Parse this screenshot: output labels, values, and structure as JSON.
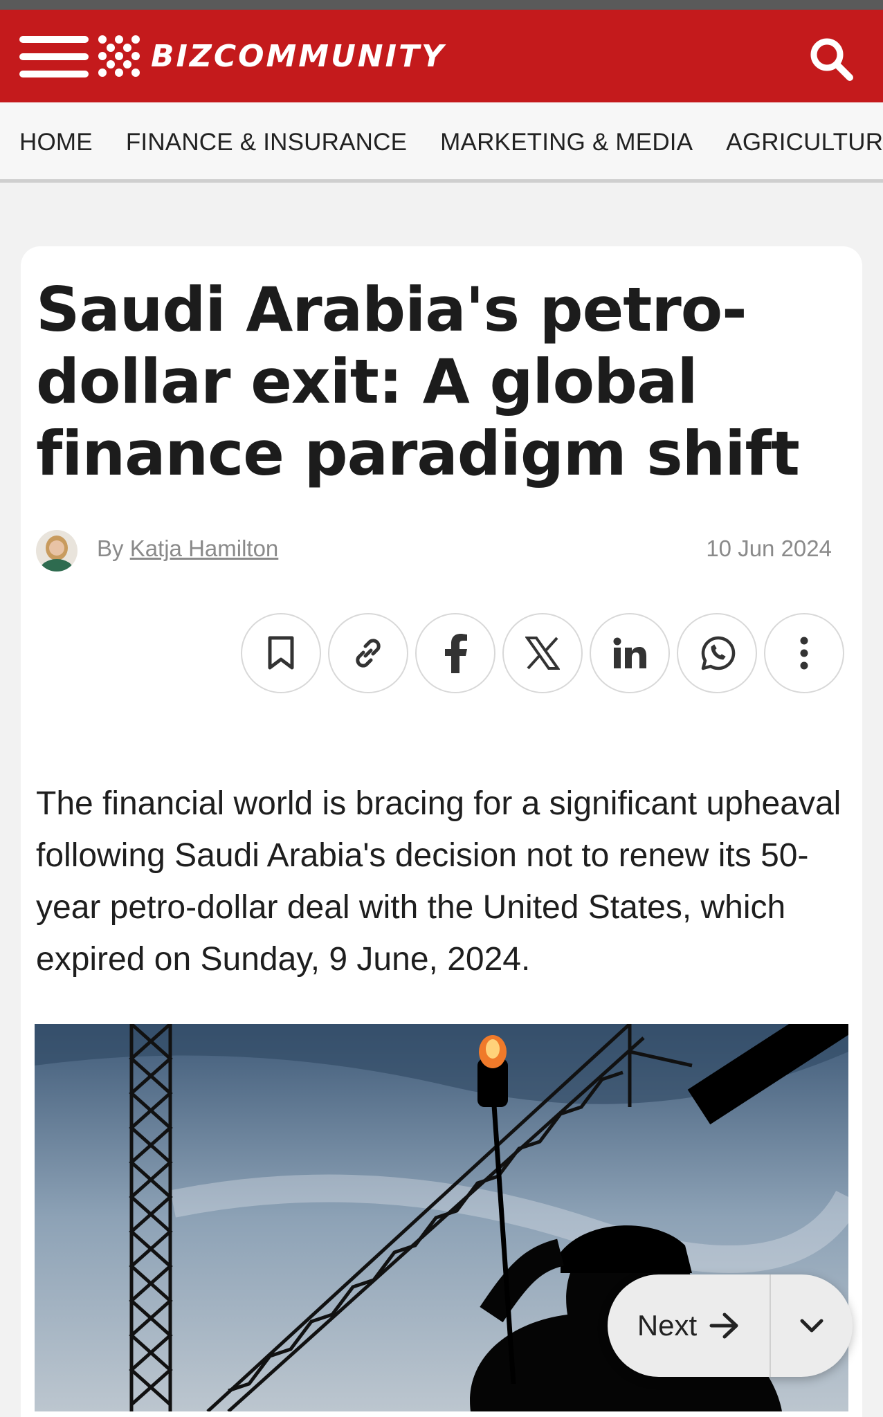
{
  "header": {
    "logo_text": "BIZCOMMUNITY",
    "brand_color": "#c41a1c",
    "icons": [
      "menu-icon",
      "search-icon"
    ]
  },
  "nav": {
    "items": [
      {
        "label": "HOME"
      },
      {
        "label": "FINANCE & INSURANCE"
      },
      {
        "label": "MARKETING & MEDIA"
      },
      {
        "label": "AGRICULTURE"
      }
    ]
  },
  "article": {
    "title": "Saudi Arabia's petro-dollar exit: A global finance paradigm shift",
    "byline_prefix": "By",
    "author": "Katja Hamilton",
    "date": "10 Jun 2024",
    "lead": "The financial world is bracing for a significant upheaval following Saudi Arabia's decision not to renew its 50-year petro-dollar deal with the United States, which expired on Sunday, 9 June, 2024."
  },
  "share": {
    "icons": [
      "bookmark-icon",
      "link-icon",
      "facebook-icon",
      "x-icon",
      "linkedin-icon",
      "whatsapp-icon",
      "more-icon"
    ]
  },
  "pager": {
    "next_label": "Next"
  }
}
